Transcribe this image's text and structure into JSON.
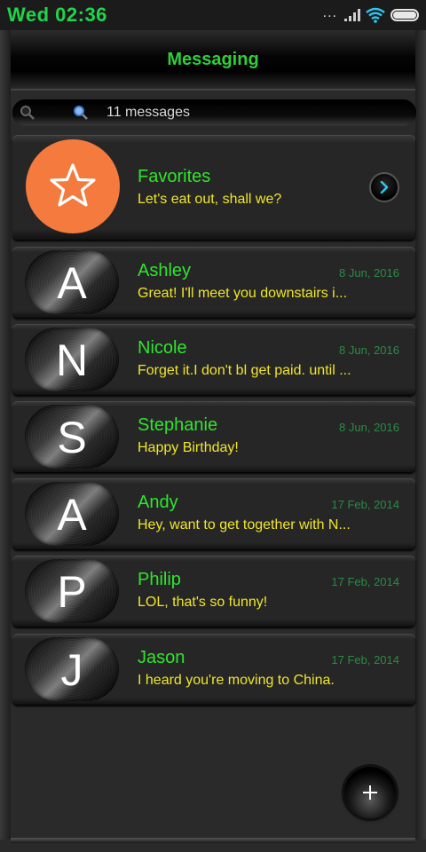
{
  "status_bar": {
    "time": "Wed 02:36",
    "overflow": "...",
    "icons": [
      "signal-icon",
      "wifi-icon",
      "battery-icon"
    ],
    "battery_level": 1.0
  },
  "header": {
    "title": "Messaging"
  },
  "search": {
    "text": "11 messages",
    "icon": "search-icon"
  },
  "favorites": {
    "name": "Favorites",
    "preview": "Let's eat out, shall we?",
    "icon": "star-icon",
    "action_icon": "chevron-right-icon"
  },
  "conversations": [
    {
      "letter": "A",
      "name": "Ashley",
      "date": "8 Jun, 2016",
      "preview": "Great! I'll meet you downstairs i...",
      "unread": false
    },
    {
      "letter": "N",
      "name": "Nicole",
      "date": "8 Jun, 2016",
      "preview": "Forget it.I don't bl get paid. until ...",
      "unread": false
    },
    {
      "letter": "S",
      "name": "Stephanie",
      "date": "8 Jun, 2016",
      "preview": "Happy Birthday!",
      "unread": true
    },
    {
      "letter": "A",
      "name": "Andy",
      "date": "17 Feb, 2014",
      "preview": "Hey, want to get together with N...",
      "unread": false
    },
    {
      "letter": "P",
      "name": "Philip",
      "date": "17 Feb, 2014",
      "preview": "LOL, that's so funny!",
      "unread": false
    },
    {
      "letter": "J",
      "name": "Jason",
      "date": "17 Feb, 2014",
      "preview": "I heard you're moving to China.",
      "unread": false
    }
  ],
  "fab": {
    "icon": "plus-icon"
  },
  "colors": {
    "accent_green": "#2ee52c",
    "preview_yellow": "#f0e62a",
    "date_green": "#2b8a45",
    "favorites_orange": "#f47a3e",
    "unread_orange": "#ff7a1a"
  }
}
